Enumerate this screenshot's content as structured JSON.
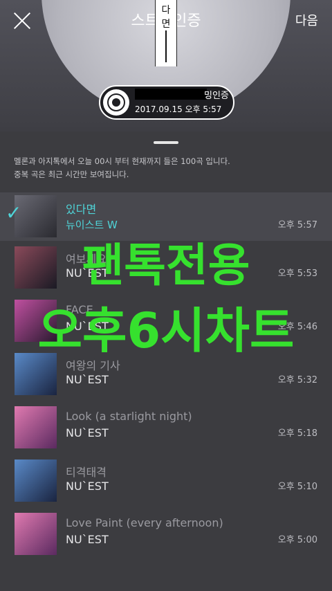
{
  "header": {
    "title": "스트밍인증",
    "next_label": "다음",
    "strip_chars": [
      "다",
      "면"
    ]
  },
  "badge": {
    "title_suffix": "밍인증",
    "timestamp": "2017.09.15 오후 5:57"
  },
  "notice": {
    "line1": "멜론과 아지톡에서 오늘 00시 부터 현재까지 들은 100곡 입니다.",
    "line2": "중복 곡은 최근 시간만 보여집니다."
  },
  "tracks": [
    {
      "title": "있다면",
      "artist": "뉴이스트 W",
      "time": "오후 5:57",
      "selected": true
    },
    {
      "title": "여보세요",
      "artist": "NU`EST",
      "time": "오후 5:53"
    },
    {
      "title": "FACE",
      "artist": "NU`EST",
      "time": "오후 5:46"
    },
    {
      "title": "여왕의 기사",
      "artist": "NU`EST",
      "time": "오후 5:32"
    },
    {
      "title": "Look (a starlight night)",
      "artist": "NU`EST",
      "time": "오후 5:18"
    },
    {
      "title": "티격태격",
      "artist": "NU`EST",
      "time": "오후 5:10"
    },
    {
      "title": "Love Paint (every afternoon)",
      "artist": "NU`EST",
      "time": "오후 5:00"
    }
  ],
  "overlay": {
    "line1": "팬톡전용",
    "line2": "오후6시차트",
    "color": "#36e12e"
  },
  "colors": {
    "accent": "#4fd4d8",
    "background": "#3c3c40"
  },
  "icons": {
    "close": "close-icon",
    "disc": "disc-icon",
    "check": "check-icon"
  }
}
